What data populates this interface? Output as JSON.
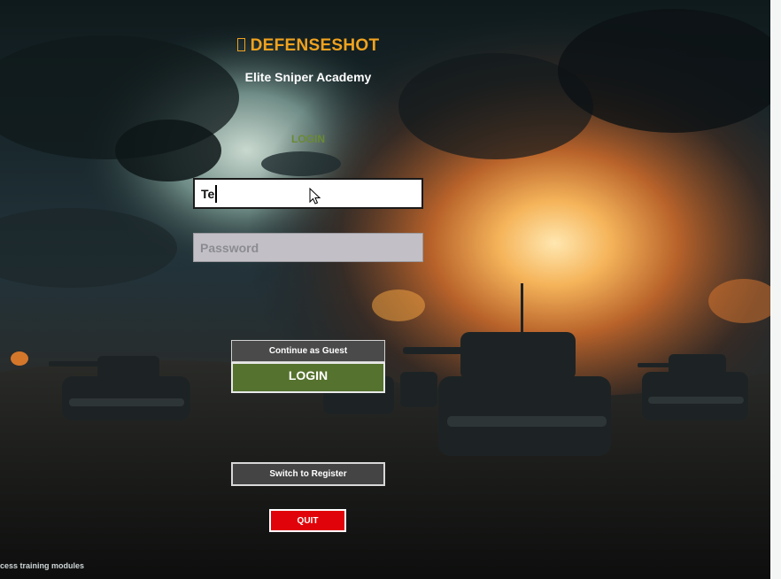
{
  "header": {
    "title": "DEFENSESHOT",
    "title_icon": "missing-glyph-icon",
    "subtitle": "Elite Sniper Academy"
  },
  "form": {
    "section_label": "LOGIN",
    "username_value": "Te",
    "password_placeholder": "Password"
  },
  "buttons": {
    "guest_label": "Continue as Guest",
    "login_label": "LOGIN",
    "register_label": "Switch to Register",
    "quit_label": "QUIT"
  },
  "footer": {
    "hint": "cess training modules"
  },
  "colors": {
    "title": "#f0a21e",
    "accent_green": "#55722e",
    "section_label": "#6b8a34",
    "quit_red": "#e0040a",
    "button_grey": "#4a4a4a"
  }
}
